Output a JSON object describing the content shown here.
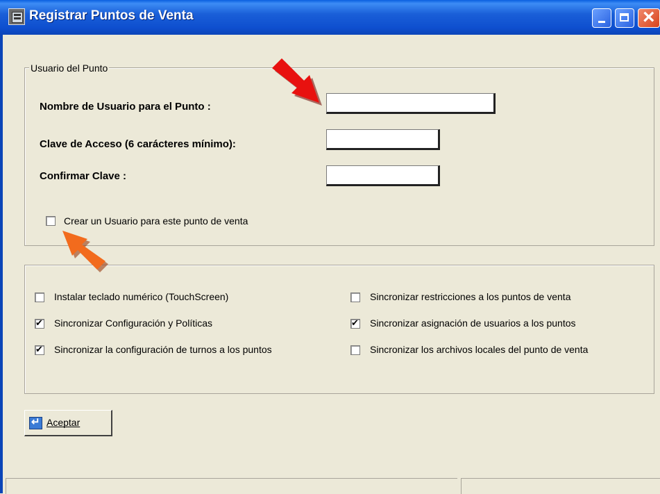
{
  "window": {
    "title": "Registrar Puntos de Venta"
  },
  "user_group": {
    "legend": "Usuario del Punto",
    "username_label": "Nombre de Usuario para el Punto :",
    "username_value": "",
    "password_label": "Clave de Acceso  (6 carácteres mínimo):",
    "password_value": "",
    "confirm_label": "Confirmar Clave :",
    "confirm_value": "",
    "create_user": {
      "label": "Crear un Usuario para este punto de venta",
      "checked": false
    }
  },
  "options": [
    {
      "label": "Instalar teclado numérico (TouchScreen)",
      "checked": false
    },
    {
      "label": "Sincronizar Configuración y Políticas",
      "checked": true
    },
    {
      "label": "Sincronizar la configuración de turnos a los puntos",
      "checked": true
    },
    {
      "label": "Sincronizar restricciones a los puntos de venta",
      "checked": false
    },
    {
      "label": "Sincronizar asignación de usuarios a los puntos",
      "checked": true
    },
    {
      "label": "Sincronizar los archivos locales del punto de venta",
      "checked": false
    }
  ],
  "accept_button": {
    "label": "Aceptar"
  },
  "status_bar": {
    "pane1": "",
    "pane2": ""
  },
  "colors": {
    "title_bar": "#0e4fcf",
    "window_bg": "#ece9d8",
    "red_arrow": "#e8110f",
    "orange_arrow": "#f26b1d"
  }
}
